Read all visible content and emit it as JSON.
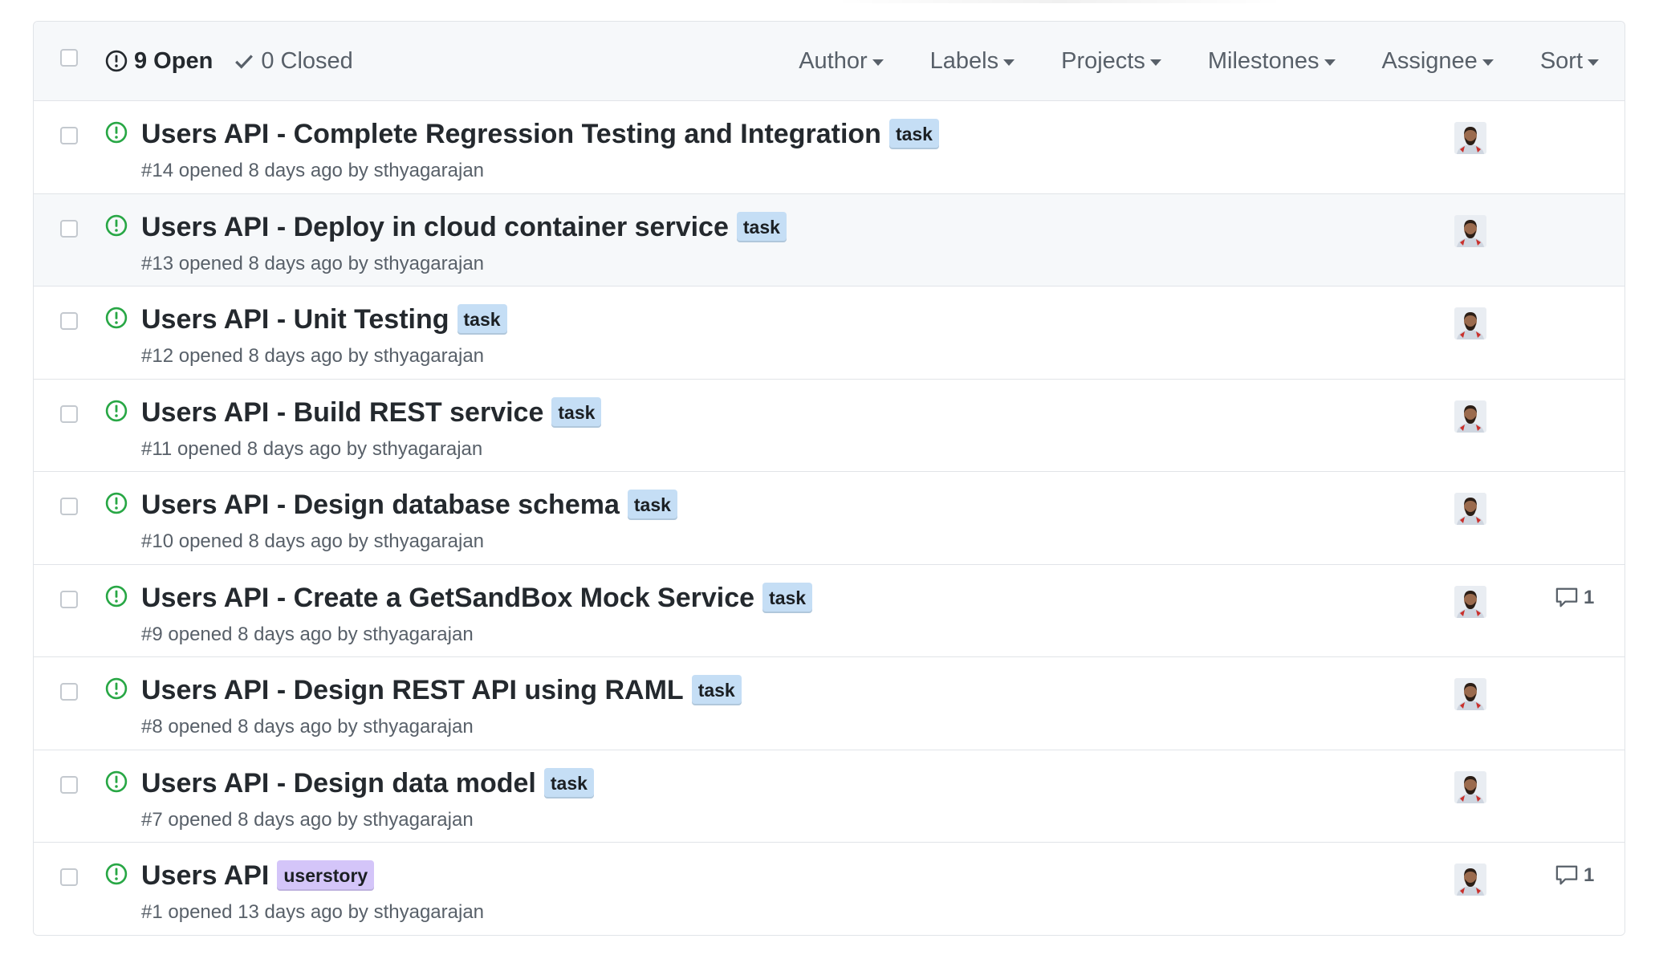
{
  "header": {
    "open_label": "9 Open",
    "closed_label": "0 Closed",
    "filters": [
      "Author",
      "Labels",
      "Projects",
      "Milestones",
      "Assignee",
      "Sort"
    ]
  },
  "colors": {
    "open_icon": "#28a745",
    "label_task": "#c5def5",
    "label_userstory": "#d4c5f9"
  },
  "issues": [
    {
      "title": "Users API - Complete Regression Testing and Integration",
      "label": "task",
      "number": "#14",
      "opened": "opened 8 days ago by",
      "author": "sthyagarajan",
      "comments": ""
    },
    {
      "title": "Users API - Deploy in cloud container service",
      "label": "task",
      "number": "#13",
      "opened": "opened 8 days ago by",
      "author": "sthyagarajan",
      "comments": ""
    },
    {
      "title": "Users API - Unit Testing",
      "label": "task",
      "number": "#12",
      "opened": "opened 8 days ago by",
      "author": "sthyagarajan",
      "comments": ""
    },
    {
      "title": "Users API - Build REST service",
      "label": "task",
      "number": "#11",
      "opened": "opened 8 days ago by",
      "author": "sthyagarajan",
      "comments": ""
    },
    {
      "title": "Users API - Design database schema",
      "label": "task",
      "number": "#10",
      "opened": "opened 8 days ago by",
      "author": "sthyagarajan",
      "comments": ""
    },
    {
      "title": "Users API - Create a GetSandBox Mock Service",
      "label": "task",
      "number": "#9",
      "opened": "opened 8 days ago by",
      "author": "sthyagarajan",
      "comments": "1"
    },
    {
      "title": "Users API - Design REST API using RAML",
      "label": "task",
      "number": "#8",
      "opened": "opened 8 days ago by",
      "author": "sthyagarajan",
      "comments": ""
    },
    {
      "title": "Users API - Design data model",
      "label": "task",
      "number": "#7",
      "opened": "opened 8 days ago by",
      "author": "sthyagarajan",
      "comments": ""
    },
    {
      "title": "Users API",
      "label": "userstory",
      "number": "#1",
      "opened": "opened 13 days ago by",
      "author": "sthyagarajan",
      "comments": "1"
    }
  ]
}
